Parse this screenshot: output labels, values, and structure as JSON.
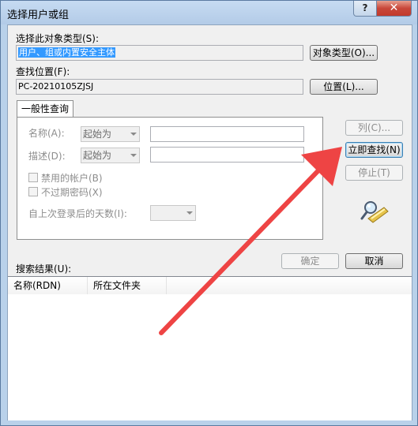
{
  "window": {
    "title": "选择用户或组",
    "help_label": "?",
    "close_label": "✕"
  },
  "object_type": {
    "label": "选择此对象类型(S):",
    "value": "用户、组或内置安全主体",
    "button": "对象类型(O)..."
  },
  "location": {
    "label": "查找位置(F):",
    "value": "PC-20210105ZJSJ",
    "button": "位置(L)..."
  },
  "tab": {
    "label": "一般性查询"
  },
  "query": {
    "name_label": "名称(A):",
    "name_combo": "起始为",
    "desc_label": "描述(D):",
    "desc_combo": "起始为",
    "disabled_accounts": "禁用的帐户(B)",
    "non_expiring_pw": "不过期密码(X)",
    "days_label": "自上次登录后的天数(I):",
    "days_value": ""
  },
  "side_buttons": {
    "columns": "列(C)...",
    "find_now": "立即查找(N)",
    "stop": "停止(T)"
  },
  "icons": {
    "search": "search-icon"
  },
  "dialog_buttons": {
    "ok": "确定",
    "cancel": "取消"
  },
  "results": {
    "label": "搜索结果(U):",
    "columns": [
      "名称(RDN)",
      "所在文件夹"
    ]
  },
  "colors": {
    "annotation_arrow": "#ee4444",
    "selection": "#3399ff"
  }
}
